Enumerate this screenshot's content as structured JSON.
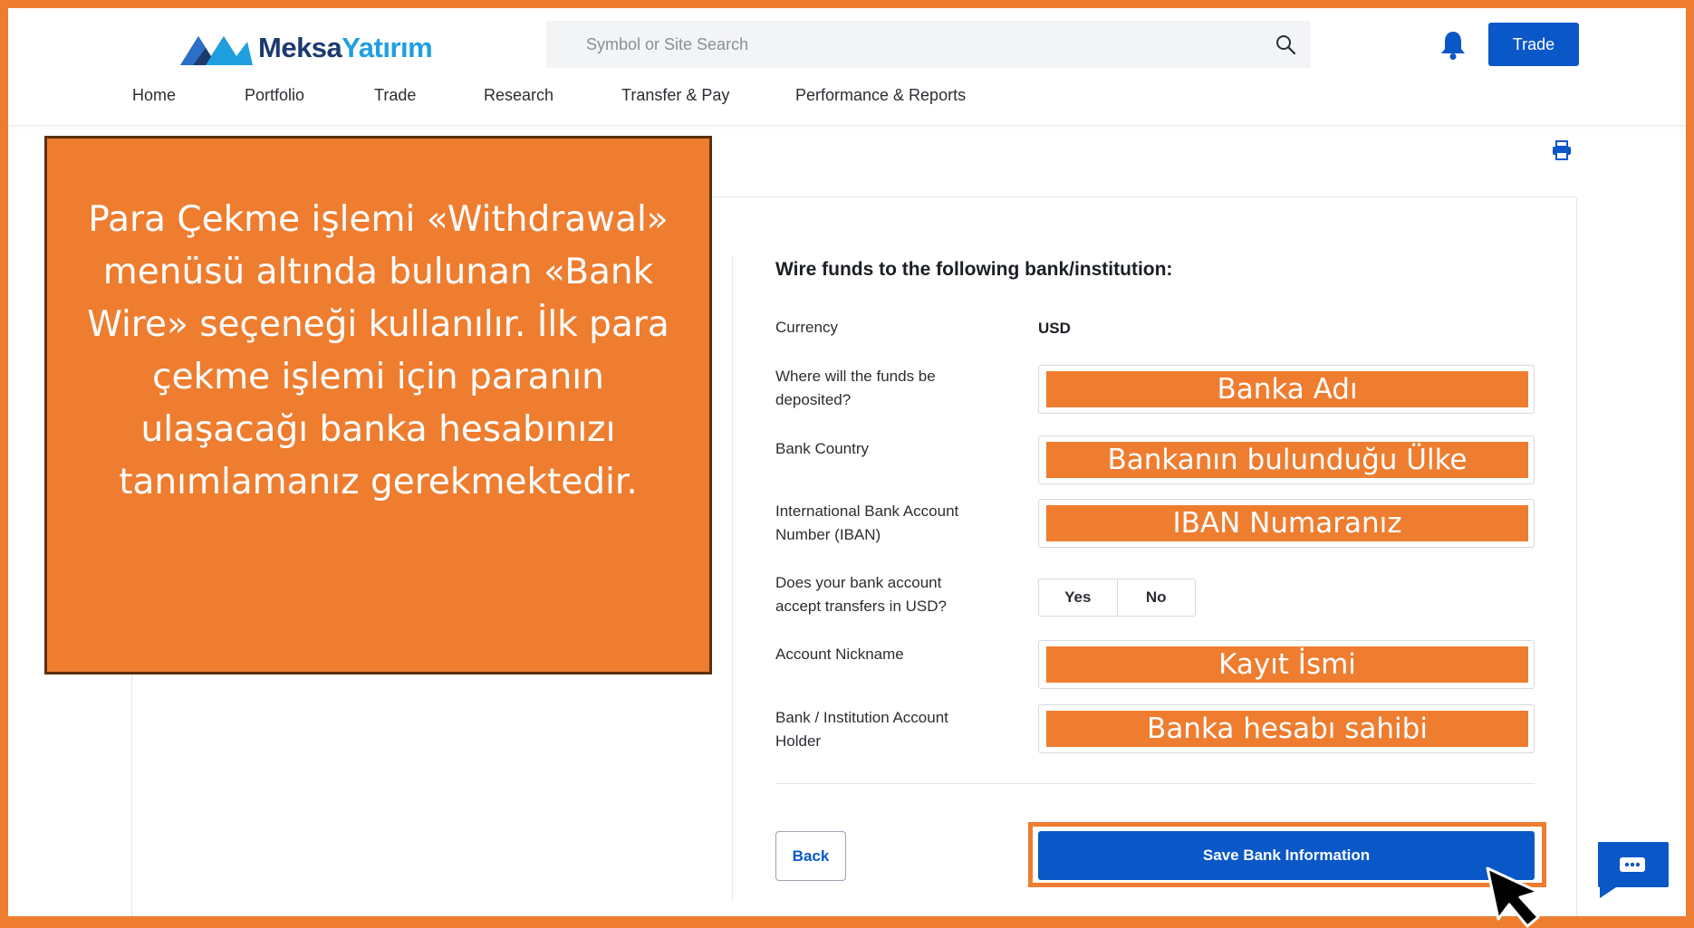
{
  "header": {
    "logo": {
      "part1": "Meksa",
      "part2": "Yatırım"
    },
    "search": {
      "placeholder": "Symbol or Site Search"
    },
    "trade_button": "Trade",
    "icons": [
      "logo-mark-icon",
      "search-icon",
      "bell-icon"
    ]
  },
  "nav": {
    "items": [
      {
        "label": "Home"
      },
      {
        "label": "Portfolio"
      },
      {
        "label": "Trade"
      },
      {
        "label": "Research"
      },
      {
        "label": "Transfer & Pay"
      },
      {
        "label": "Performance & Reports"
      }
    ]
  },
  "callout": {
    "text": "Para Çekme işlemi «Withdrawal» menüsü altında bulunan «Bank Wire» seçeneği kullanılır. İlk para çekme işlemi için paranın ulaşacağı banka hesabınızı tanımlamanız gerekmektedir."
  },
  "form": {
    "title": "Wire funds to the following bank/institution:",
    "currency_label": "Currency",
    "currency_value": "USD",
    "deposit_label": "Where will the funds be deposited?",
    "deposit_overlay": "Banka Adı",
    "country_label": "Bank Country",
    "country_overlay": "Bankanın bulunduğu Ülke",
    "iban_label": "International Bank Account Number (IBAN)",
    "iban_overlay": "IBAN Numaranız",
    "usd_question_label": "Does your bank account accept transfers in USD?",
    "yes": "Yes",
    "no": "No",
    "nickname_label": "Account Nickname",
    "nickname_overlay": "Kayıt İsmi",
    "holder_label": "Bank / Institution Account Holder",
    "holder_overlay": "Banka hesabı sahibi",
    "back_button": "Back",
    "save_button": "Save Bank Information"
  },
  "colors": {
    "accent_orange": "#ee7d30",
    "brand_blue": "#0a57c8",
    "logo_dark": "#1d3a6e",
    "logo_light": "#1e9fe0"
  }
}
